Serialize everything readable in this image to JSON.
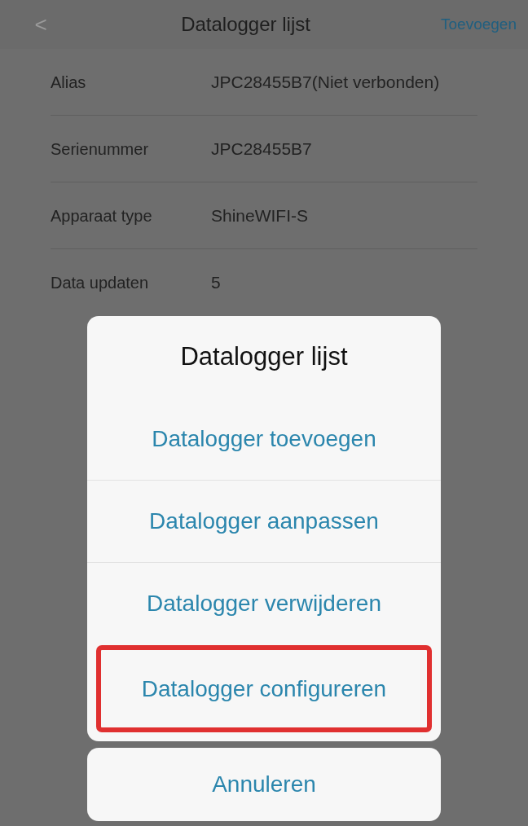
{
  "header": {
    "back": "<",
    "title": "Datalogger lijst",
    "action": "Toevoegen"
  },
  "details": [
    {
      "label": "Alias",
      "value": "JPC28455B7(Niet verbonden)"
    },
    {
      "label": "Serienummer",
      "value": "JPC28455B7"
    },
    {
      "label": "Apparaat type",
      "value": "ShineWIFI-S"
    },
    {
      "label": "Data updaten",
      "value": "5"
    }
  ],
  "sheet": {
    "title": "Datalogger lijst",
    "actions": [
      {
        "label": "Datalogger toevoegen",
        "highlighted": false
      },
      {
        "label": "Datalogger aanpassen",
        "highlighted": false
      },
      {
        "label": "Datalogger verwijderen",
        "highlighted": false
      },
      {
        "label": "Datalogger configureren",
        "highlighted": true
      }
    ],
    "cancel": "Annuleren"
  }
}
